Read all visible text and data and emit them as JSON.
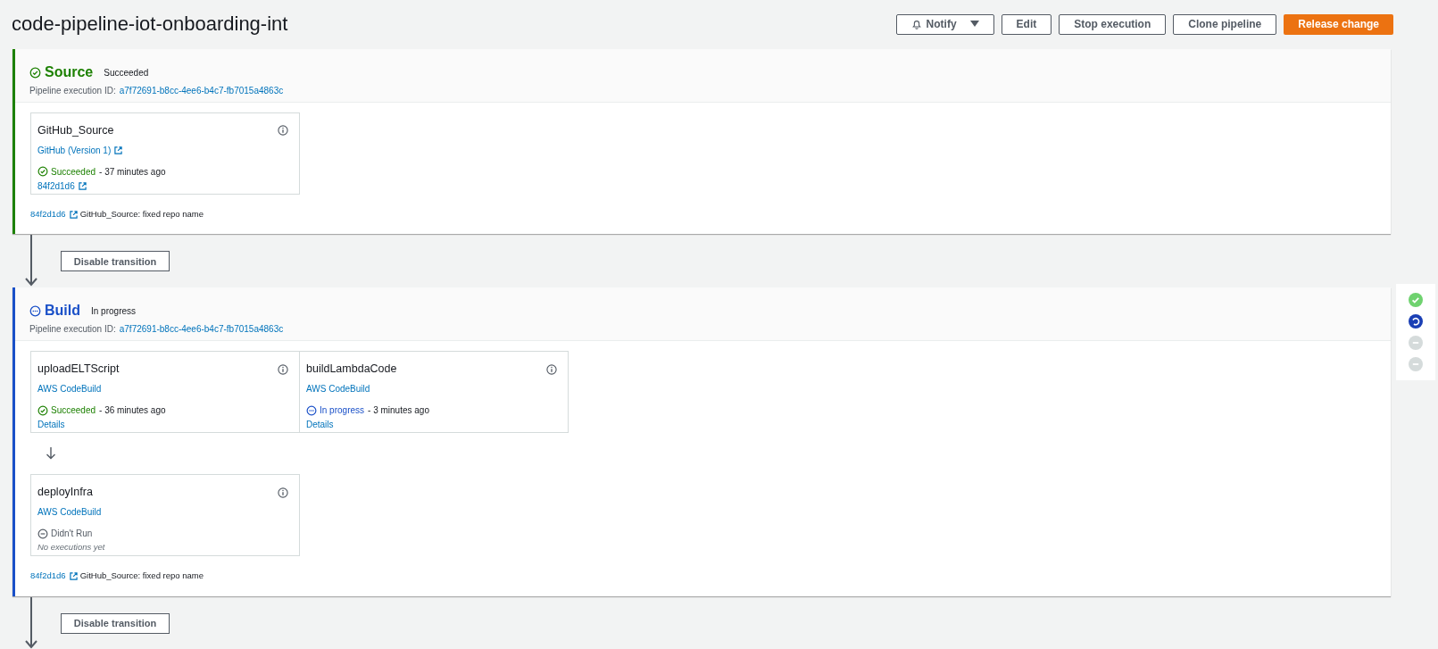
{
  "title": "code-pipeline-iot-onboarding-int",
  "header_buttons": [
    {
      "label": "Notify",
      "kind": "notify"
    },
    {
      "label": "Edit",
      "kind": "normal"
    },
    {
      "label": "Stop execution",
      "kind": "normal"
    },
    {
      "label": "Clone pipeline",
      "kind": "normal"
    },
    {
      "label": "Release change",
      "kind": "primary"
    }
  ],
  "stages": [
    {
      "name": "Source",
      "kind": "succeeded",
      "status_text": "Succeeded",
      "execution_label": "Pipeline execution ID:",
      "execution_id": "a7f72691-b8cc-4ee6-b4c7-fb7015a4863c",
      "action_groups": [
        [
          {
            "name": "GitHub_Source",
            "provider": "GitHub (Version 1)",
            "provider_external": true,
            "kind": "succeeded",
            "status_text": "Succeeded",
            "time": "- 37 minutes ago",
            "link": "84f2d1d6",
            "link_external": true
          }
        ]
      ],
      "revision": {
        "id": "84f2d1d6",
        "message": "GitHub_Source: fixed repo name"
      },
      "transition": {
        "button": "Disable transition"
      }
    },
    {
      "name": "Build",
      "kind": "in_progress",
      "status_text": "In progress",
      "execution_label": "Pipeline execution ID:",
      "execution_id": "a7f72691-b8cc-4ee6-b4c7-fb7015a4863c",
      "action_groups": [
        [
          {
            "name": "uploadELTScript",
            "provider": "AWS CodeBuild",
            "provider_external": false,
            "kind": "succeeded",
            "status_text": "Succeeded",
            "time": "- 36 minutes ago",
            "link": "Details",
            "link_external": false
          },
          {
            "name": "buildLambdaCode",
            "provider": "AWS CodeBuild",
            "provider_external": false,
            "kind": "in_progress",
            "status_text": "In progress",
            "time": "- 3 minutes ago",
            "link": "Details",
            "link_external": false
          }
        ],
        [
          {
            "name": "deployInfra",
            "provider": "AWS CodeBuild",
            "provider_external": false,
            "kind": "didnt_run",
            "status_text": "Didn't Run",
            "note": "No executions yet"
          }
        ]
      ],
      "revision": {
        "id": "84f2d1d6",
        "message": "GitHub_Source: fixed repo name"
      },
      "transition": {
        "button": "Disable transition"
      }
    }
  ],
  "stage_overview": [
    {
      "kind": "succeeded"
    },
    {
      "kind": "in_progress"
    },
    {
      "kind": "didnt_run"
    },
    {
      "kind": "didnt_run"
    }
  ]
}
